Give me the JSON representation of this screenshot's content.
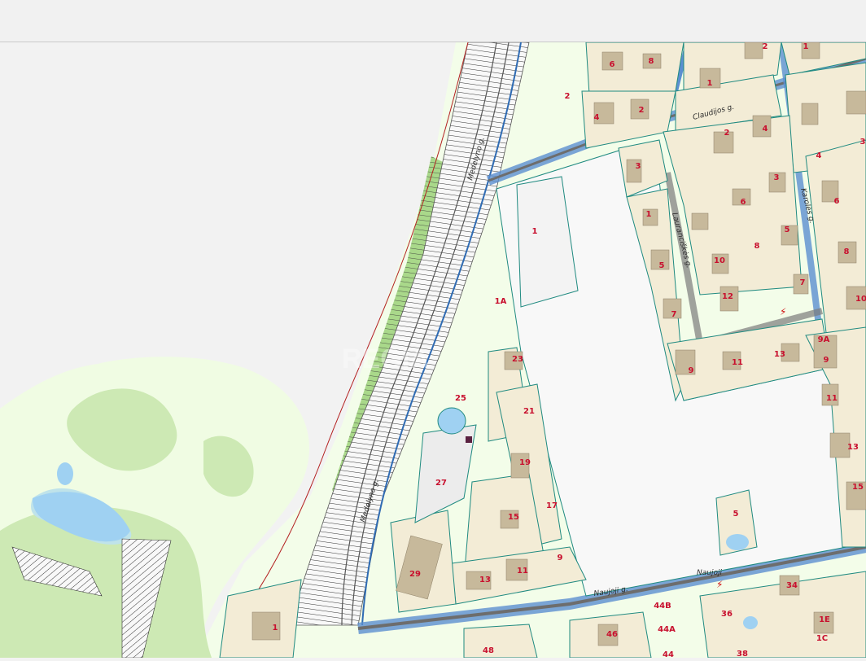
{
  "streets": {
    "medelyno_upper": "Medelyno g.",
    "medelyno_lower": "Medelyno g.",
    "claudijos": "Claudijos g.",
    "lauranciskes": "Lauranciškės g.",
    "karoles": "Karolės g.",
    "naujoji_right": "Naujoji",
    "naujoji_left": "Naujoji g."
  },
  "plots": [
    {
      "id": "p-2-top",
      "label": "2"
    },
    {
      "id": "p-1-open",
      "label": "1"
    },
    {
      "id": "p-1a",
      "label": "1A"
    },
    {
      "id": "p-23",
      "label": "23"
    },
    {
      "id": "p-25",
      "label": "25"
    },
    {
      "id": "p-21",
      "label": "21"
    },
    {
      "id": "p-27",
      "label": "27"
    },
    {
      "id": "p-19",
      "label": "19"
    },
    {
      "id": "p-17",
      "label": "17"
    },
    {
      "id": "p-15-left",
      "label": "15"
    },
    {
      "id": "p-29",
      "label": "29"
    },
    {
      "id": "p-13-left",
      "label": "13"
    },
    {
      "id": "p-11-left",
      "label": "11"
    },
    {
      "id": "p-9-left",
      "label": "9"
    },
    {
      "id": "p-1-bottom",
      "label": "1"
    },
    {
      "id": "p-48",
      "label": "48"
    },
    {
      "id": "p-46",
      "label": "46"
    },
    {
      "id": "p-44b",
      "label": "44B"
    },
    {
      "id": "p-44a",
      "label": "44A"
    },
    {
      "id": "p-44",
      "label": "44"
    },
    {
      "id": "p-36",
      "label": "36"
    },
    {
      "id": "p-38",
      "label": "38"
    },
    {
      "id": "p-34",
      "label": "34"
    },
    {
      "id": "p-1e",
      "label": "1E"
    },
    {
      "id": "p-1c",
      "label": "1C"
    },
    {
      "id": "p-5-pond",
      "label": "5"
    },
    {
      "id": "p-6-top",
      "label": "6"
    },
    {
      "id": "p-8-top",
      "label": "8"
    },
    {
      "id": "p-4-top",
      "label": "4"
    },
    {
      "id": "p-2-mid",
      "label": "2"
    },
    {
      "id": "p-2-right",
      "label": "2"
    },
    {
      "id": "p-1-right",
      "label": "1"
    },
    {
      "id": "p-2-topright",
      "label": "2"
    },
    {
      "id": "p-1-topright",
      "label": "1"
    },
    {
      "id": "p-4-right",
      "label": "4"
    },
    {
      "id": "p-3-right",
      "label": "3"
    },
    {
      "id": "p-3-edge",
      "label": "3"
    },
    {
      "id": "p-4-right2",
      "label": "4"
    },
    {
      "id": "p-6-right",
      "label": "6"
    },
    {
      "id": "p-6-mid",
      "label": "6"
    },
    {
      "id": "p-5-right",
      "label": "5"
    },
    {
      "id": "p-8-mid",
      "label": "8"
    },
    {
      "id": "p-8-right",
      "label": "8"
    },
    {
      "id": "p-7-right",
      "label": "7"
    },
    {
      "id": "p-10-right",
      "label": "10"
    },
    {
      "id": "p-10-mid",
      "label": "10"
    },
    {
      "id": "p-12",
      "label": "12"
    },
    {
      "id": "p-7-mid",
      "label": "7"
    },
    {
      "id": "p-5-mid",
      "label": "5"
    },
    {
      "id": "p-3-mid",
      "label": "3"
    },
    {
      "id": "p-1-mid",
      "label": "1"
    },
    {
      "id": "p-9-mid",
      "label": "9"
    },
    {
      "id": "p-11-mid",
      "label": "11"
    },
    {
      "id": "p-13-mid",
      "label": "13"
    },
    {
      "id": "p-9a",
      "label": "9A"
    },
    {
      "id": "p-9-right",
      "label": "9"
    },
    {
      "id": "p-11-right",
      "label": "11"
    },
    {
      "id": "p-13-right",
      "label": "13"
    },
    {
      "id": "p-15-right",
      "label": "15"
    }
  ],
  "watermark": "REGIA",
  "colors": {
    "background": "#f2f2f2",
    "open_area": "#f3fde9",
    "parcel": "#f3ecd6",
    "parcel_border": "#1f8a80",
    "road_main": "#4a7fc1",
    "railway": "#3b3b3b",
    "water": "#9fd1f2",
    "forest": "#cde9b4",
    "label": "#c8102e",
    "utility_line": "#b32020"
  }
}
